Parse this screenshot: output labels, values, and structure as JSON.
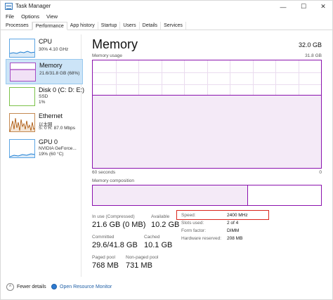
{
  "window": {
    "title": "Task Manager",
    "buttons": {
      "minimize": "—",
      "maximize": "☐",
      "close": "✕"
    }
  },
  "menu": [
    "File",
    "Options",
    "View"
  ],
  "tabs": [
    "Processes",
    "Performance",
    "App history",
    "Startup",
    "Users",
    "Details",
    "Services"
  ],
  "active_tab": "Performance",
  "sidebar": {
    "items": [
      {
        "name": "CPU",
        "line1": "30% 4.10 GHz",
        "line2": "",
        "icon": "cpu-graph-thumbnail",
        "color": "#1d7ed3"
      },
      {
        "name": "Memory",
        "line1": "21.6/31.8 GB (68%)",
        "line2": "",
        "icon": "memory-graph-thumbnail",
        "color": "#8b12ae",
        "selected": true
      },
      {
        "name": "Disk 0 (C: D: E:)",
        "line1": "SSD",
        "line2": "1%",
        "icon": "disk-graph-thumbnail",
        "color": "#4da60c"
      },
      {
        "name": "Ethernet",
        "line1": "以太网",
        "line2": "S: 0  R: 87.0 Mbps",
        "icon": "ethernet-graph-thumbnail",
        "color": "#a74f01"
      },
      {
        "name": "GPU 0",
        "line1": "NVIDIA GeForce...",
        "line2": "19% (60 °C)",
        "icon": "gpu-graph-thumbnail",
        "color": "#1d7ed3"
      }
    ]
  },
  "main": {
    "title": "Memory",
    "total": "32.0 GB",
    "chart_label": "Memory usage",
    "chart_max": "31.8 GB",
    "time_left": "60 seconds",
    "time_right": "0",
    "usage_fraction": 0.68,
    "composition_label": "Memory composition",
    "composition_used_fraction": 0.68,
    "stats": {
      "in_use_label": "In use (Compressed)",
      "in_use_value": "21.6 GB (0 MB)",
      "available_label": "Available",
      "available_value": "10.2 GB",
      "committed_label": "Committed",
      "committed_value": "29.6/41.8 GB",
      "cached_label": "Cached",
      "cached_value": "10.1 GB",
      "paged_label": "Paged pool",
      "paged_value": "768 MB",
      "nonpaged_label": "Non-paged pool",
      "nonpaged_value": "731 MB"
    },
    "hardware": {
      "speed_label": "Speed:",
      "speed_value": "2400 MHz",
      "slots_label": "Slots used:",
      "slots_value": "2 of 4",
      "form_label": "Form factor:",
      "form_value": "DIMM",
      "reserved_label": "Hardware reserved:",
      "reserved_value": "208 MB"
    },
    "highlight_color": "#d9261c"
  },
  "footer": {
    "fewer_details": "Fewer details",
    "open_monitor": "Open Resource Monitor"
  }
}
